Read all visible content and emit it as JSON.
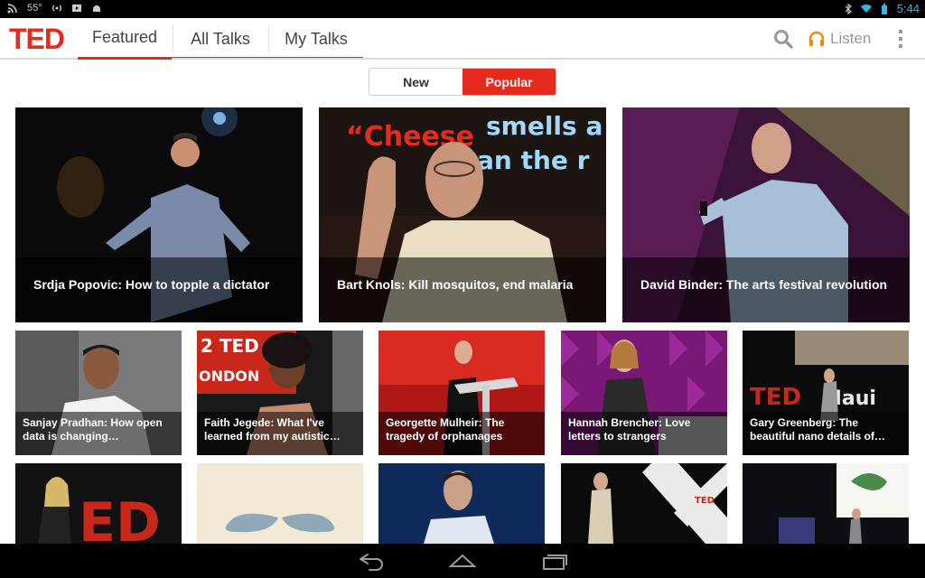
{
  "status_bar": {
    "temperature": "55°",
    "time": "5:44",
    "icons_left": [
      "rss-icon",
      "wifi-broadcast-icon",
      "media-icon",
      "android-icon"
    ],
    "icons_right": [
      "bluetooth-icon",
      "wifi-icon",
      "battery-icon"
    ]
  },
  "action_bar": {
    "logo": "TED",
    "tabs": [
      {
        "label": "Featured",
        "active": true
      },
      {
        "label": "All Talks",
        "active": false
      },
      {
        "label": "My Talks",
        "active": false
      }
    ],
    "listen_label": "Listen",
    "accent_color": "#e62b1e"
  },
  "segment": {
    "options": [
      {
        "label": "New",
        "active": false
      },
      {
        "label": "Popular",
        "active": true
      }
    ]
  },
  "featured_talks": [
    {
      "title": "Srdja Popovic: How to topple a dictator"
    },
    {
      "title": "Bart Knols: Kill mosquitos, end malaria"
    },
    {
      "title": "David Binder: The arts festival revolution"
    }
  ],
  "talks_row_2": [
    {
      "title": "Sanjay Pradhan: How open data is changing…"
    },
    {
      "title": "Faith Jegede: What I've learned from my autistic…"
    },
    {
      "title": "Georgette Mulheir: The tragedy of orphanages"
    },
    {
      "title": "Hannah Brencher: Love letters to strangers"
    },
    {
      "title": "Gary Greenberg: The beautiful nano details of…"
    }
  ],
  "nav_bar": {
    "buttons": [
      "back-icon",
      "home-icon",
      "recents-icon"
    ]
  }
}
